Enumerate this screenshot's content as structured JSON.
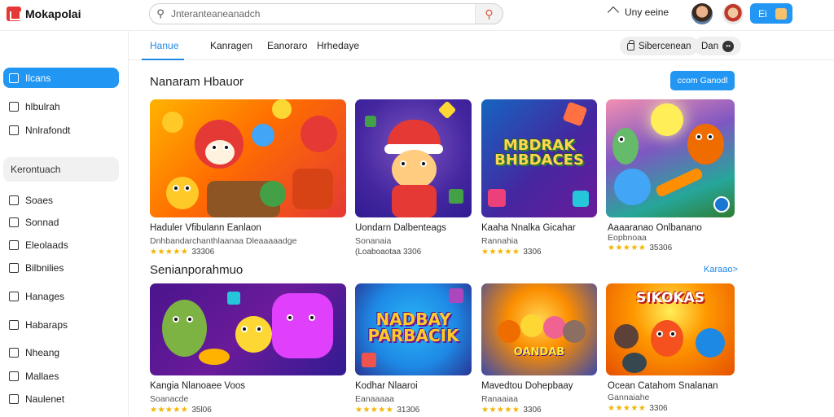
{
  "app": {
    "name": "Mokapolai"
  },
  "search": {
    "value": "Jnteranteaneanadch"
  },
  "topbar": {
    "upload_label": "Uny eeine",
    "account_label": "Ei"
  },
  "sidebar": {
    "items": [
      {
        "label": "Ilcans",
        "active": true
      },
      {
        "label": "hlbulrah"
      },
      {
        "label": "Nnlrafondt"
      },
      {
        "label": "Kerontuach",
        "section": true
      },
      {
        "label": "Soaes"
      },
      {
        "label": "Sonnad"
      },
      {
        "label": "Eleolaads"
      },
      {
        "label": "Bilbnilies"
      },
      {
        "label": "Hanages"
      },
      {
        "label": "Habaraps"
      },
      {
        "label": "Nheang"
      },
      {
        "label": "Mallaes"
      },
      {
        "label": "Naulenet"
      }
    ]
  },
  "tabs": [
    {
      "label": "Hanue",
      "active": true
    },
    {
      "label": "Kanragen"
    },
    {
      "label": "Eanoraro"
    },
    {
      "label": "Hrhedaye"
    }
  ],
  "chips": {
    "sort_label": "Sibercenean",
    "more_label": "Dan"
  },
  "sections": [
    {
      "title": "Nanaram Hbauor",
      "action_label": "ccom Ganodl",
      "cards": [
        {
          "title": "Haduler Vfibulann Eanlaon",
          "sub": "Dnhbandarchanthlaanaa Dleaaaaadge",
          "rating_text": "33306"
        },
        {
          "title": "Uondarn Dalbenteags",
          "sub": "Sonanaia",
          "rating_text": "(Loaboaotaa 3306"
        },
        {
          "title": "Kaaha Nnalka Gicahar",
          "sub": "Rannahia",
          "rating_text": "3306"
        },
        {
          "title": "Aaaaranao Onlbanano",
          "sub": "Eopbnoaa",
          "rating_text": "35306"
        }
      ]
    },
    {
      "title": "Senianporahmuo",
      "more_label": "Karaao>",
      "cards": [
        {
          "title": "Kangia Nlanoaee Voos",
          "sub": "Soanacde",
          "rating_text": "35l06"
        },
        {
          "title": "Kodhar Nlaaroi",
          "sub": "Eanaaaaa",
          "rating_text": "31306"
        },
        {
          "title": "Mavedtou Dohepbaay",
          "sub": "Ranaaiaa",
          "rating_text": "3306"
        },
        {
          "title": "Ocean Catahom Snalanan",
          "sub": "Gannaiahe",
          "rating_text": "3306"
        }
      ]
    }
  ],
  "art_text": {
    "card3": "MBDRAK\nBHBDACES",
    "card6": "NADBAY\nPARBACIK",
    "card7": "OANDAB",
    "card8": "SIKOKAS"
  },
  "colors": {
    "accent": "#2196f3",
    "star": "#f4b400",
    "logo": "#e53935"
  }
}
